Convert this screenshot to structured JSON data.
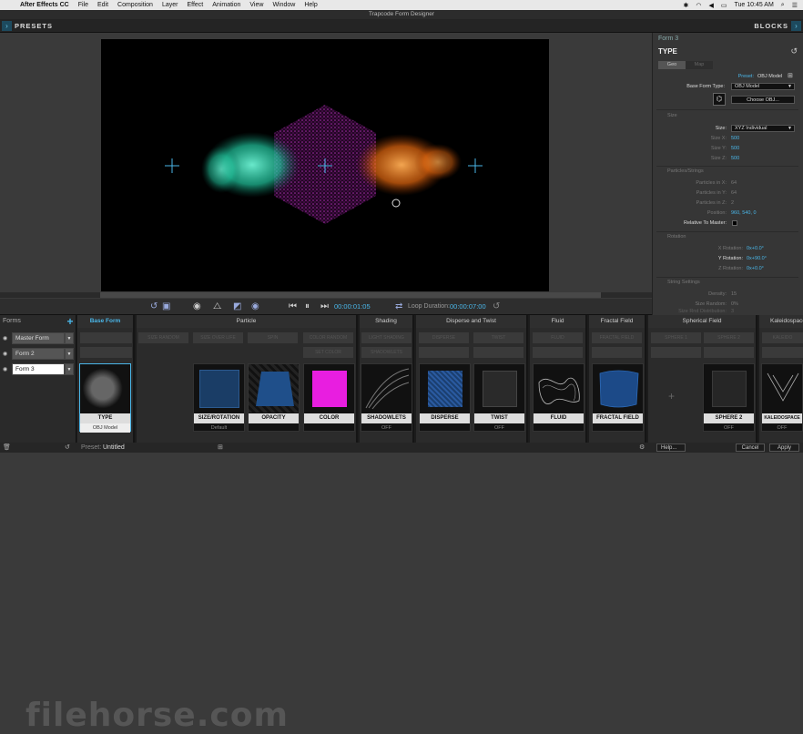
{
  "menubar": {
    "app": "After Effects CC",
    "items": [
      "File",
      "Edit",
      "Composition",
      "Layer",
      "Effect",
      "Animation",
      "View",
      "Window",
      "Help"
    ],
    "clock": "Tue 10:45 AM"
  },
  "window": {
    "title": "Trapcode Form Designer"
  },
  "topbar": {
    "presets": "PRESETS",
    "blocks": "BLOCKS"
  },
  "transport": {
    "timecode": "00:00:01:05",
    "loop_label": "Loop Duration:",
    "loop_value": "00:00:07:00"
  },
  "right_panel": {
    "form_title": "Form 3",
    "header": "TYPE",
    "tabs": [
      "Geo",
      "Map"
    ],
    "preset_label": "Preset:",
    "preset_value": "OBJ Model",
    "base_form_label": "Base Form Type:",
    "base_form_value": "OBJ Model",
    "choose_btn": "Choose OBJ...",
    "size_section": "Size",
    "size_label": "Size:",
    "size_value": "XYZ Individual",
    "size_rows": [
      {
        "label": "Size X:",
        "value": "500"
      },
      {
        "label": "Size Y:",
        "value": "500"
      },
      {
        "label": "Size Z:",
        "value": "500"
      }
    ],
    "particles_section": "Particles/Strings",
    "particle_rows": [
      {
        "label": "Particles in X:",
        "value": "64"
      },
      {
        "label": "Particles in Y:",
        "value": "64"
      },
      {
        "label": "Particles in Z:",
        "value": "2"
      }
    ],
    "position_label": "Position:",
    "position_value": "960, 540, 0",
    "relative_label": "Relative To Master:",
    "rotation_section": "Rotation",
    "rotation_rows": [
      {
        "label": "X Rotation:",
        "value": "0x+0.0°"
      },
      {
        "label": "Y Rotation:",
        "value": "0x+90.0°"
      },
      {
        "label": "Z Rotation:",
        "value": "0x+0.0°"
      }
    ],
    "string_section": "String Settings",
    "string_rows": [
      {
        "label": "Density:",
        "value": "15"
      },
      {
        "label": "Size Random:",
        "value": "0%"
      },
      {
        "label": "Size Rnd Distribution:",
        "value": "3"
      }
    ]
  },
  "forms_panel": {
    "header": "Forms",
    "items": [
      "Master Form",
      "Form 2",
      "Form 3"
    ]
  },
  "columns": {
    "base_form": "Base Form",
    "particle": "Particle",
    "shading": "Shading",
    "disperse": "Disperse and Twist",
    "fluid": "Fluid",
    "fractal": "Fractal Field",
    "spherical": "Spherical Field",
    "kaleido": "Kaleidospace"
  },
  "placeholders": {
    "p1": "SIZE RANDOM",
    "p2": "SIZE OVER LIFE",
    "p3": "SPIN",
    "p4": "COLOR RANDOM",
    "p5": "SET COLOR",
    "s1": "LIGHT SHADING",
    "s2": "SHADOWLETS",
    "d1": "DISPERSE",
    "d2": "TWIST",
    "fl1": "FLUID",
    "ff1": "FRACTAL FIELD",
    "sf1": "SPHERE 1",
    "sf2": "SPHERE 2",
    "k1": "KALEIDO"
  },
  "cards": [
    {
      "label": "TYPE",
      "sub": "OBJ Model"
    },
    {
      "label": "SIZE/ROTATION",
      "sub": "Default"
    },
    {
      "label": "OPACITY",
      "sub": ""
    },
    {
      "label": "COLOR",
      "sub": ""
    },
    {
      "label": "SHADOWLETS",
      "sub": "OFF"
    },
    {
      "label": "DISPERSE",
      "sub": ""
    },
    {
      "label": "TWIST",
      "sub": "OFF"
    },
    {
      "label": "FLUID",
      "sub": ""
    },
    {
      "label": "FRACTAL FIELD",
      "sub": ""
    },
    {
      "label": "SPHERE 2",
      "sub": "OFF"
    },
    {
      "label": "KALEIDOSPACE",
      "sub": "OFF"
    }
  ],
  "statusbar": {
    "preset_label": "Preset:",
    "preset_value": "Untitled",
    "help": "Help...",
    "cancel": "Cancel",
    "apply": "Apply"
  },
  "watermark": "filehorse.com",
  "colors": {
    "accent": "#4ab6e8",
    "teal": "#2ee0b8",
    "magenta": "#c82ad0",
    "orange": "#f07a1a"
  }
}
